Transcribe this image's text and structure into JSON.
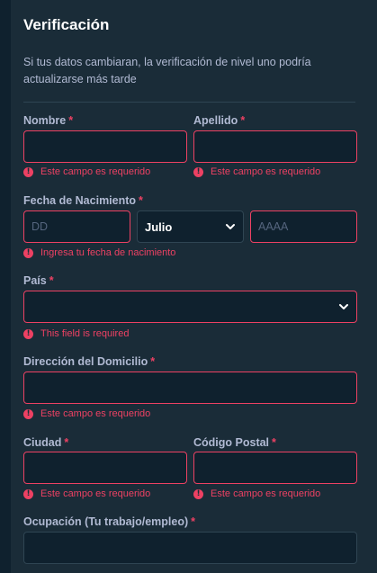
{
  "title": "Verificación",
  "subtitle": "Si tus datos cambiaran, la verificación de nivel uno podría actualizarse más tarde",
  "required_mark": "*",
  "error_icon": "!",
  "fields": {
    "nombre": {
      "label": "Nombre",
      "error": "Este campo es requerido"
    },
    "apellido": {
      "label": "Apellido",
      "error": "Este campo es requerido"
    },
    "fecha": {
      "label": "Fecha de Nacimiento",
      "day_placeholder": "DD",
      "month_value": "Julio",
      "year_placeholder": "AAAA",
      "error": "Ingresa tu fecha de nacimiento"
    },
    "pais": {
      "label": "País",
      "value": "",
      "error": "This field is required"
    },
    "direccion": {
      "label": "Dirección del Domicilio",
      "error": "Este campo es requerido"
    },
    "ciudad": {
      "label": "Ciudad",
      "error": "Este campo es requerido"
    },
    "codigo_postal": {
      "label": "Código Postal",
      "error": "Este campo es requerido"
    },
    "ocupacion": {
      "label": "Ocupación (Tu trabajo/empleo)"
    }
  },
  "colors": {
    "background": "#1a2c38",
    "input_bg": "#0f212e",
    "error": "#ed4163",
    "label": "#b1bad3",
    "title": "#ffffff"
  },
  "icons": {
    "error": "exclamation-circle-icon",
    "select": "chevron-down-icon"
  }
}
